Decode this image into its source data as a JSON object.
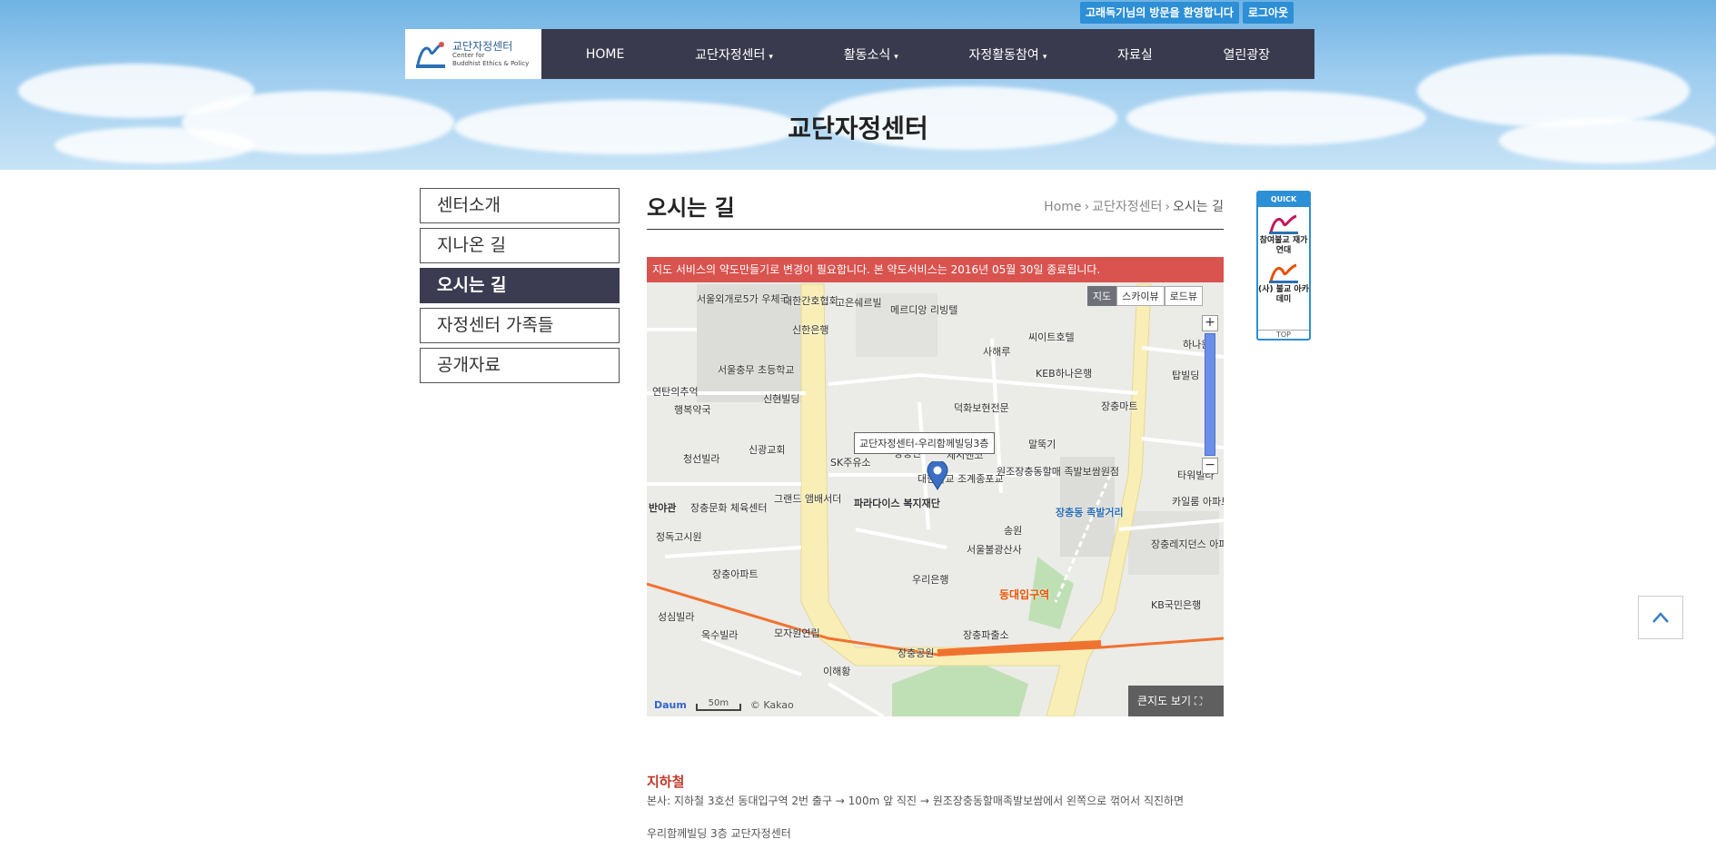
{
  "header": {
    "welcome": "고래독기님의 방문을 환영합니다",
    "logout": "로그아웃",
    "logo_title": "교단자정센터",
    "logo_sub1": "Center for",
    "logo_sub2": "Buddhist Ethics & Policy",
    "menu": [
      {
        "label": "HOME",
        "dropdown": false
      },
      {
        "label": "교단자정센터",
        "dropdown": true
      },
      {
        "label": "활동소식",
        "dropdown": true
      },
      {
        "label": "자정활동참여",
        "dropdown": true
      },
      {
        "label": "자료실",
        "dropdown": false
      },
      {
        "label": "열린광장",
        "dropdown": false
      }
    ],
    "caret": "▾",
    "hero_title": "교단자정센터"
  },
  "sidebar": {
    "items": [
      {
        "label": "센터소개",
        "active": false
      },
      {
        "label": "지나온 길",
        "active": false
      },
      {
        "label": "오시는 길",
        "active": true
      },
      {
        "label": "자정센터 가족들",
        "active": false
      },
      {
        "label": "공개자료",
        "active": false
      }
    ]
  },
  "page": {
    "title": "오시는 길",
    "breadcrumb": [
      "Home",
      "교단자정센터",
      "오시는 길"
    ],
    "sep": "›"
  },
  "map": {
    "notice": "지도 서비스의 약도만들기로 변경이 필요합니다. 본 약도서비스는 2016년 05월 30일 종료됩니다.",
    "types": [
      "지도",
      "스카이뷰",
      "로드뷰"
    ],
    "pin_label": "교단자정센터-우리함께빌딩3층",
    "big_map": "큰지도 보기",
    "brand": "Daum",
    "scale": "50m",
    "copyright": "© Kakao",
    "zoom_in": "+",
    "zoom_out": "−",
    "labels": [
      "서울외개로5가 우체국",
      "대한간호협회",
      "고은쉐르빌",
      "메르디앙 리빙텔",
      "신한은행",
      "사해루",
      "씨이트호텔",
      "하나원",
      "서울충무 초등학교",
      "KEB하나은행",
      "탑빌딩",
      "연탄의추억",
      "행복약국",
      "신현빌딩",
      "장충마트",
      "덕화보현전문",
      "신광교회",
      "청선빌라",
      "SK주유소",
      "장충단",
      "제시앤코",
      "말뚝기",
      "대한불교 조계종포교",
      "원조장충동할매 족발보쌈원점",
      "파라다이스 복지재단",
      "장충문화 체육센터",
      "반야관",
      "그랜드 앰배서더",
      "송원",
      "장충동 족발거리",
      "타워빌라",
      "카일룸 아파트",
      "장충레지던스 아파트",
      "정독고시원",
      "서울불광산사",
      "장충아파트",
      "우리은행",
      "동대입구역",
      "KB국민은행",
      "성심빌라",
      "옥수빌라",
      "모자원연립",
      "장충파출소",
      "장충공원",
      "이해황"
    ]
  },
  "directions": {
    "heading": "지하철",
    "line1": "본사: 지하철 3호선 동대입구역 2번 출구 → 100m 앞 직진 → 원조장충동할매족발보쌈에서 왼쪽으로 꺾어서 직진하면",
    "line2": "우리함께빌딩 3층 교단자정센터"
  },
  "quick": {
    "title": "QUICK",
    "item1": "참여불교 재가연대",
    "item2": "(사) 불교 아카데미",
    "top": "TOP"
  },
  "colors": {
    "nav_bg": "#3a3a4e",
    "accent": "#2d8fd6",
    "notice_bg": "#d9534f",
    "heading_red": "#c0392b"
  }
}
